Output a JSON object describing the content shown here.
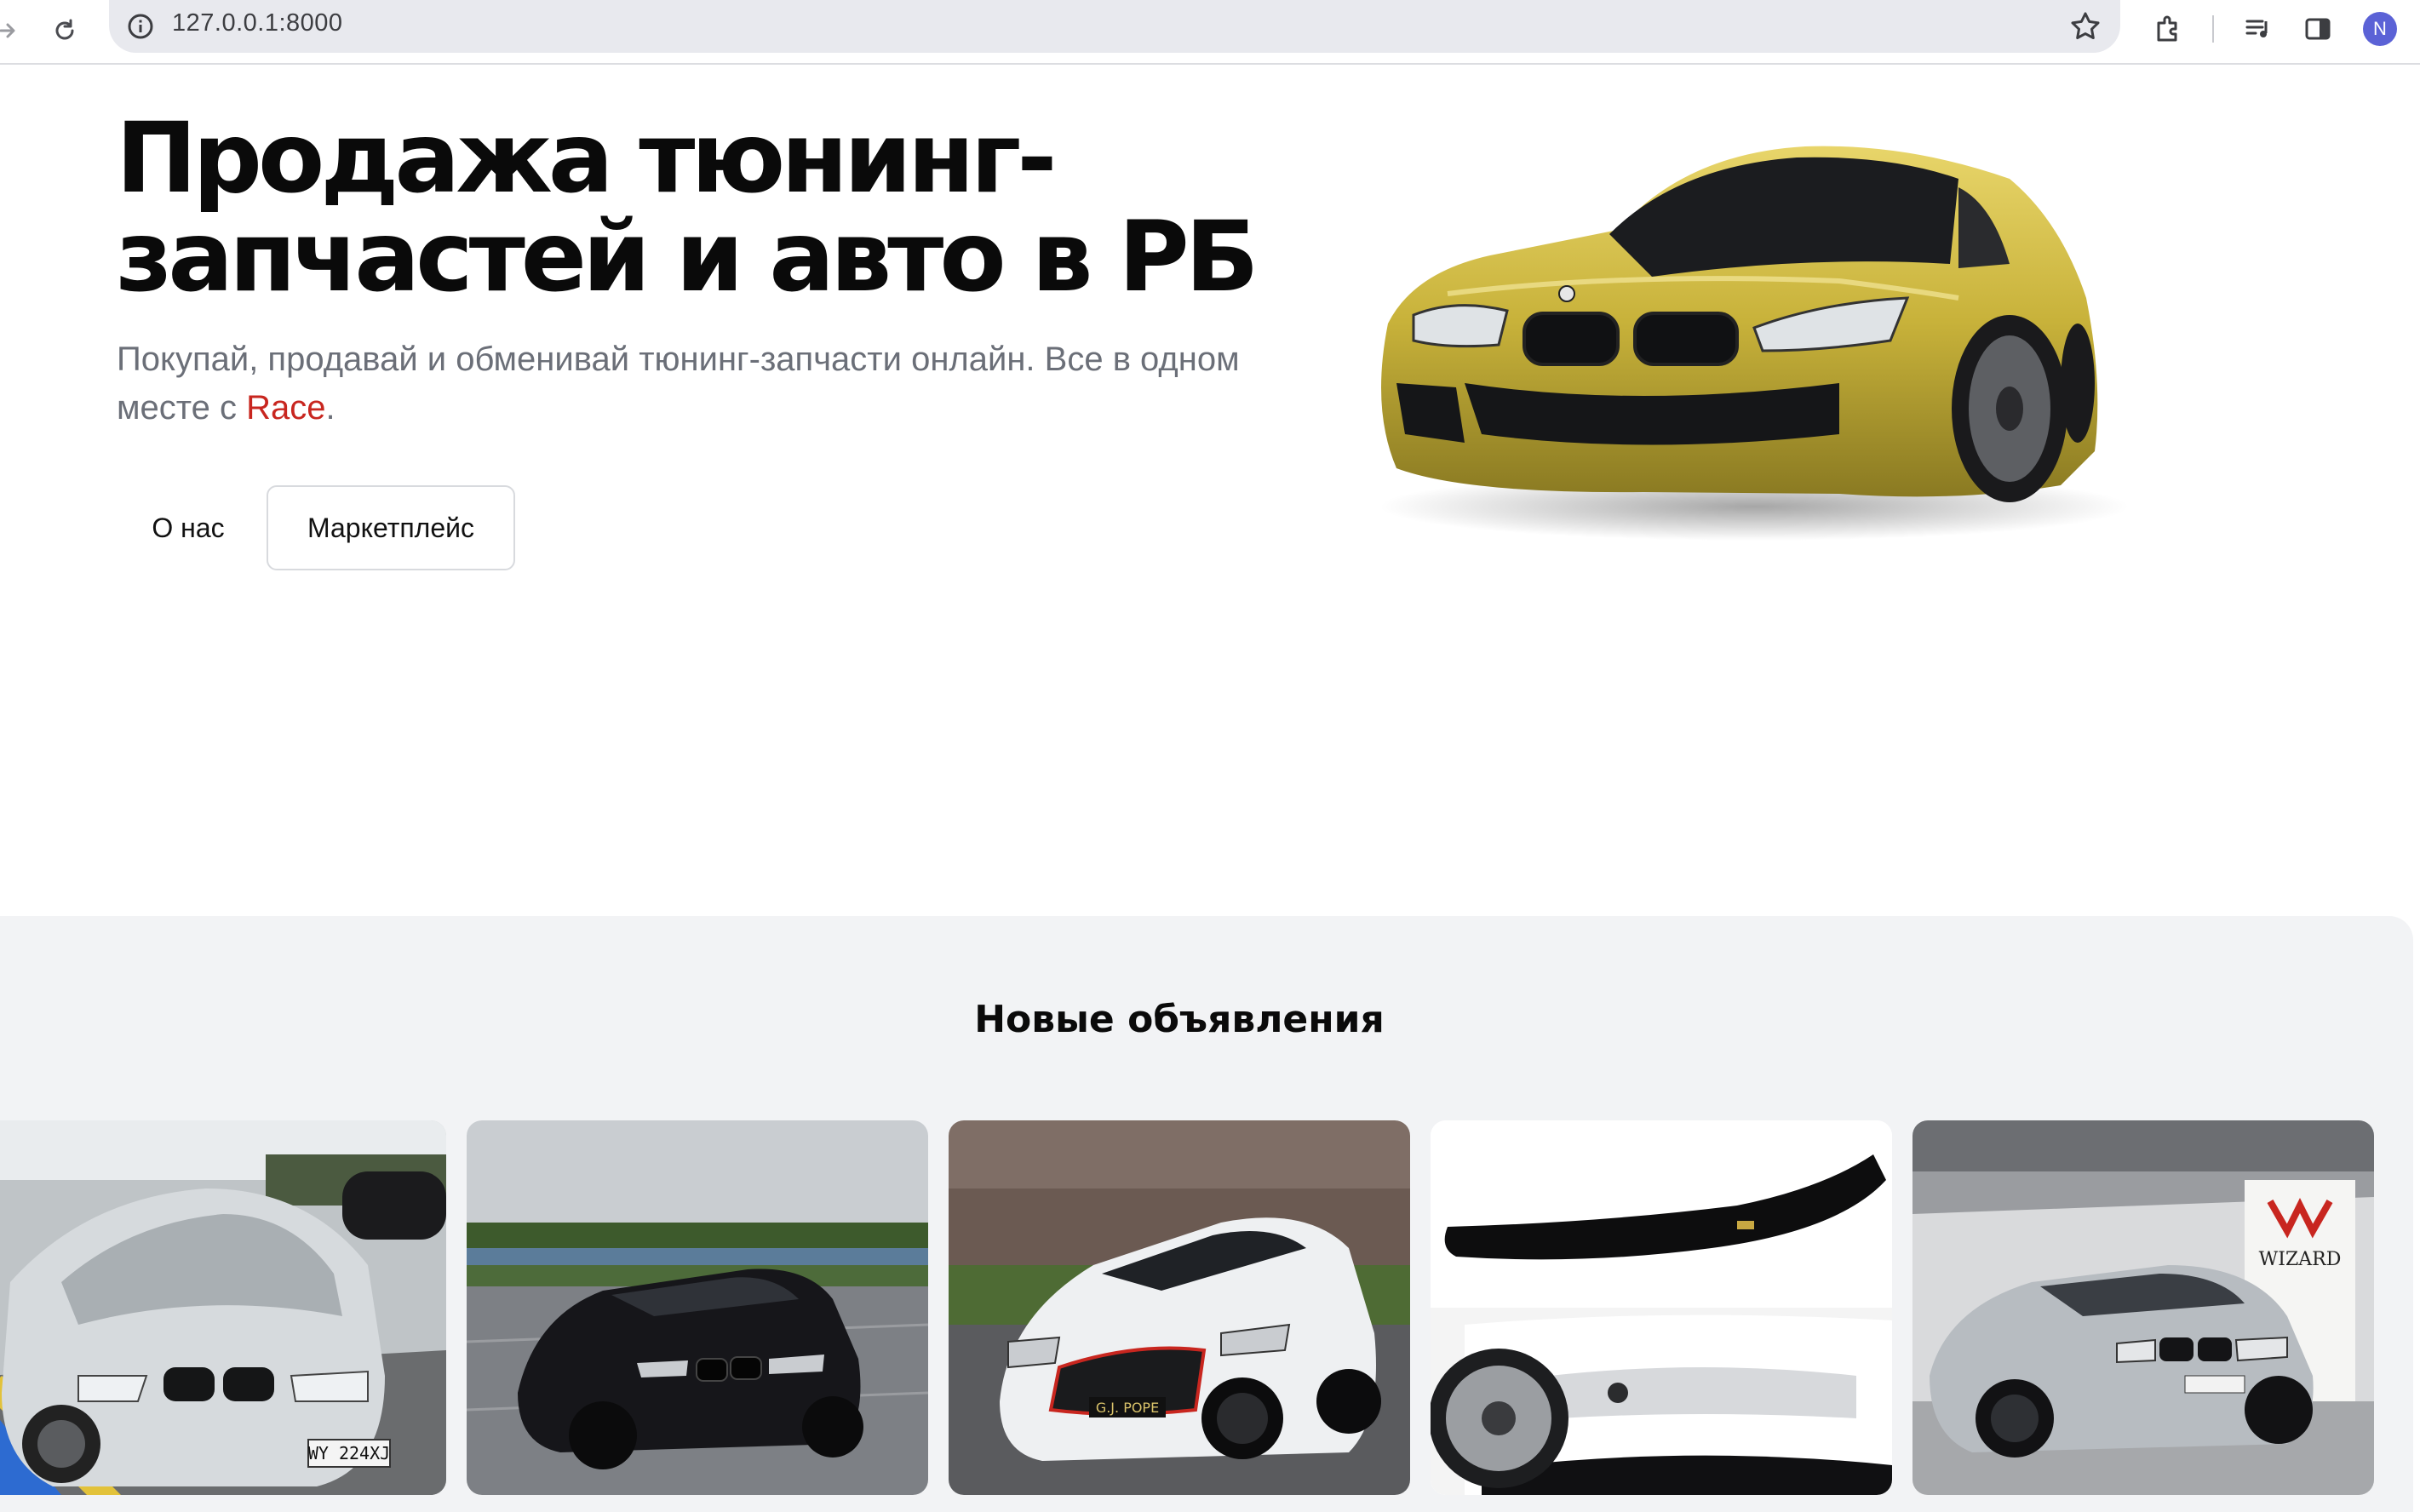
{
  "browser": {
    "url": "127.0.0.1:8000",
    "profile_initial": "N"
  },
  "hero": {
    "title": "Продажа тюнинг-запчастей и авто в РБ",
    "subtitle_prefix": "Покупай, продавай и обменивай тюнинг-запчасти онлайн. Все в одном месте с ",
    "brand": "Race",
    "subtitle_suffix": ".",
    "buttons": {
      "about": "О нас",
      "marketplace": "Маркетплейс"
    },
    "image_icon": "yellow-bmw-m4"
  },
  "listings": {
    "title": "Новые объявления",
    "cards": [
      {
        "image": "silver-bmw-e46-convertible",
        "plate": "WY 224XJ"
      },
      {
        "image": "black-bmw-e60-sedan"
      },
      {
        "image": "white-audi-rs3-sportback",
        "plate": "G.J. POPE"
      },
      {
        "image": "black-front-lip-spoiler"
      },
      {
        "image": "grey-bmw-m3-e92",
        "sign": "WIZARD"
      }
    ]
  },
  "colors": {
    "accent": "#c8261f",
    "section_bg": "#f2f3f5",
    "subtitle": "#6b6f78"
  }
}
